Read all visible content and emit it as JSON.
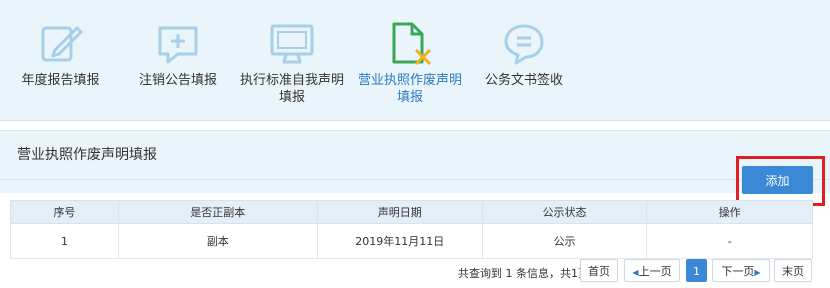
{
  "nav": {
    "items": [
      {
        "label": "年度报告填报",
        "icon": "edit-icon"
      },
      {
        "label": "注销公告填报",
        "icon": "add-message-icon"
      },
      {
        "label": "执行标准自我声明填报",
        "line1": "执行标准自我声明",
        "line2": "填报",
        "icon": "monitor-icon"
      },
      {
        "label": "营业执照作废声明填报",
        "line1": "营业执照作废声明",
        "line2": "填报",
        "icon": "document-cancel-icon",
        "active": true
      },
      {
        "label": "公务文书签收",
        "icon": "message-icon"
      }
    ]
  },
  "section": {
    "title": "营业执照作废声明填报",
    "add_label": "添加"
  },
  "table": {
    "headers": [
      "序号",
      "是否正副本",
      "声明日期",
      "公示状态",
      "操作"
    ],
    "rows": [
      [
        "1",
        "副本",
        "2019年11月11日",
        "公示",
        "-"
      ]
    ]
  },
  "pager": {
    "info": "共查询到 1 条信息，共1页",
    "first": "首页",
    "prev": "上一页",
    "current": "1",
    "next": "下一页",
    "last": "末页"
  },
  "colors": {
    "accent": "#3b88d6",
    "active_icon": "#3aa657",
    "icon": "#a8cfe8",
    "highlight": "#e02020"
  }
}
